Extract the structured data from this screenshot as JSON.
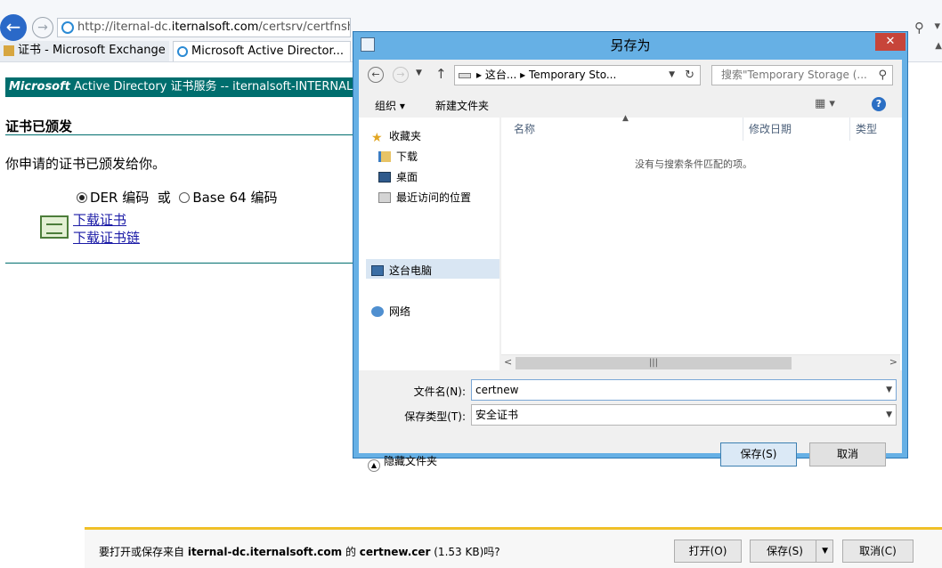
{
  "browser": {
    "url_prefix": "http://iternal-dc.",
    "url_domain": "iternalsoft.com",
    "url_suffix": "/certsrv/certfnsh.asp",
    "tabs": [
      {
        "label": "证书 - Microsoft Exchange"
      },
      {
        "label": "Microsoft Active Director..."
      }
    ]
  },
  "page": {
    "banner_brand": "Microsoft",
    "banner_text": " Active Directory 证书服务  --  iternalsoft-INTERNAL-DC-CA",
    "heading": "证书已颁发",
    "message": "你申请的证书已颁发给你。",
    "encoding": {
      "der_label": "DER 编码",
      "or_label": "或",
      "base64_label": "Base 64 编码",
      "selected": "DER"
    },
    "download_cert": "下载证书",
    "download_chain": "下载证书链"
  },
  "dialog": {
    "title": "另存为",
    "close_label": "✕",
    "path_seg1": "这台...",
    "path_seg2": "Temporary Sto...",
    "search_placeholder": "搜索\"Temporary Storage (...",
    "organize_label": "组织",
    "new_folder_label": "新建文件夹",
    "nav": {
      "favorites": "收藏夹",
      "downloads": "下载",
      "desktop": "桌面",
      "recent": "最近访问的位置",
      "this_pc": "这台电脑",
      "network": "网络"
    },
    "columns": {
      "name": "名称",
      "date": "修改日期",
      "type": "类型"
    },
    "empty_message": "没有与搜索条件匹配的项。",
    "filename_label": "文件名(N):",
    "filename_value": "certnew",
    "filetype_label": "保存类型(T):",
    "filetype_value": "安全证书",
    "hide_folders_label": "隐藏文件夹",
    "save_label": "保存(S)",
    "cancel_label": "取消"
  },
  "download_bar": {
    "prompt_prefix": "要打开或保存来自 ",
    "host": "iternal-dc.iternalsoft.com",
    "prompt_mid": " 的 ",
    "filename": "certnew.cer",
    "size": " (1.53 KB)吗?",
    "open_label": "打开(O)",
    "save_label": "保存(S)",
    "cancel_label": "取消(C)"
  },
  "colors": {
    "banner": "#006e6e",
    "dialog_frame": "#66b0e5",
    "close_button": "#c7453a",
    "notification_accent": "#f0c028"
  }
}
